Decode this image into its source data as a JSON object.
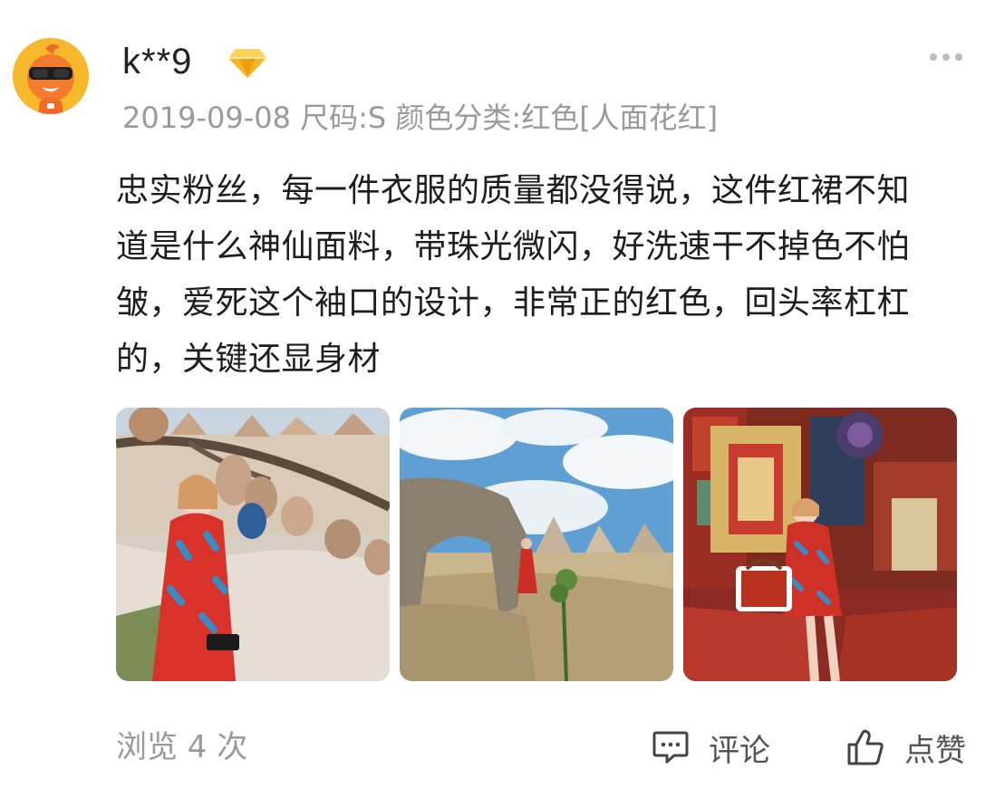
{
  "user": {
    "name": "k**9",
    "badge_icon": "diamond-icon",
    "badge_color": "#f5b620"
  },
  "meta": {
    "date": "2019-09-08",
    "spec": "尺码:S 颜色分类:红色[人面花红]"
  },
  "review": {
    "text": "忠实粉丝，每一件衣服的质量都没得说，这件红裙不知道是什么神仙面料，带珠光微闪，好洗速干不掉色不怕皱，爱死这个袖口的设计，非常正的红色，回头率杠杠的，关键还显身材"
  },
  "footer": {
    "views_label": "浏览 4 次",
    "comment_label": "评论",
    "like_label": "点赞"
  },
  "icons": {
    "more": "more-dots-icon",
    "comment": "comment-icon",
    "like": "thumbs-up-icon"
  }
}
